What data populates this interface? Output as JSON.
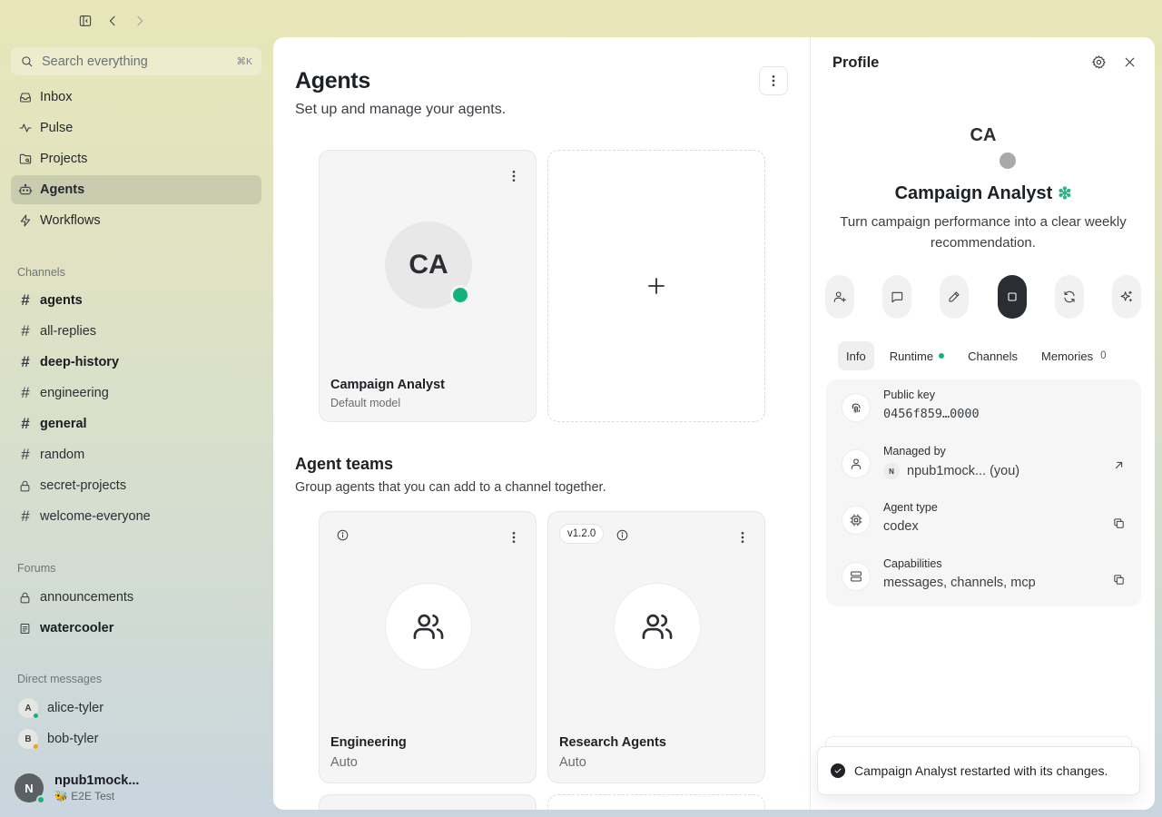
{
  "sidebar": {
    "search": {
      "placeholder": "Search everything",
      "shortcut": "⌘K"
    },
    "nav": [
      {
        "label": "Inbox",
        "icon": "inbox-icon"
      },
      {
        "label": "Pulse",
        "icon": "pulse-icon"
      },
      {
        "label": "Projects",
        "icon": "projects-icon"
      },
      {
        "label": "Agents",
        "icon": "bot-icon",
        "active": true
      },
      {
        "label": "Workflows",
        "icon": "lightning-icon"
      }
    ],
    "channels_title": "Channels",
    "channels": [
      {
        "label": "agents",
        "bold": true
      },
      {
        "label": "all-replies",
        "bold": false
      },
      {
        "label": "deep-history",
        "bold": true
      },
      {
        "label": "engineering",
        "bold": false
      },
      {
        "label": "general",
        "bold": true
      },
      {
        "label": "random",
        "bold": false
      },
      {
        "label": "secret-projects",
        "bold": false,
        "private": true
      },
      {
        "label": "welcome-everyone",
        "bold": false
      }
    ],
    "forums_title": "Forums",
    "forums": [
      {
        "label": "announcements",
        "bold": false,
        "private": true
      },
      {
        "label": "watercooler",
        "bold": true
      }
    ],
    "dms_title": "Direct messages",
    "dms": [
      {
        "initial": "A",
        "label": "alice-tyler",
        "status_color": "#16b37a"
      },
      {
        "initial": "B",
        "label": "bob-tyler",
        "status_color": "#f0a020"
      }
    ],
    "me": {
      "initial": "N",
      "name": "npub1mock...",
      "status": "🐝 E2E Test"
    }
  },
  "main": {
    "title": "Agents",
    "subtitle": "Set up and manage your agents.",
    "agent_card": {
      "initials": "CA",
      "name": "Campaign Analyst",
      "model": "Default model"
    },
    "teams_title": "Agent teams",
    "teams_subtitle": "Group agents that you can add to a channel together.",
    "teams": [
      {
        "name": "Engineering",
        "mode": "Auto",
        "version": ""
      },
      {
        "name": "Research Agents",
        "mode": "Auto",
        "version": "v1.2.0"
      }
    ]
  },
  "profile": {
    "title": "Profile",
    "initials": "CA",
    "name": "Campaign Analyst",
    "description": "Turn campaign performance into a clear weekly recommendation.",
    "actions": [
      "add-member-icon",
      "message-icon",
      "edit-icon",
      "stop-icon",
      "restart-icon",
      "sparkle-icon"
    ],
    "tabs": {
      "info": "Info",
      "runtime": "Runtime",
      "channels": "Channels",
      "memories": "Memories",
      "memories_count": "0"
    },
    "rows": {
      "public_key": {
        "label": "Public key",
        "value": "0456f859…0000"
      },
      "managed_by": {
        "label": "Managed by",
        "initial": "N",
        "value": "npub1mock... (you)"
      },
      "agent_type": {
        "label": "Agent type",
        "value": "codex"
      },
      "capabilities": {
        "label": "Capabilities",
        "value": "messages, channels, mcp"
      }
    }
  },
  "toast": {
    "message": "Campaign Analyst restarted with its changes."
  },
  "colors": {
    "online": "#13b27a",
    "accent_dark": "#2a2d31"
  }
}
